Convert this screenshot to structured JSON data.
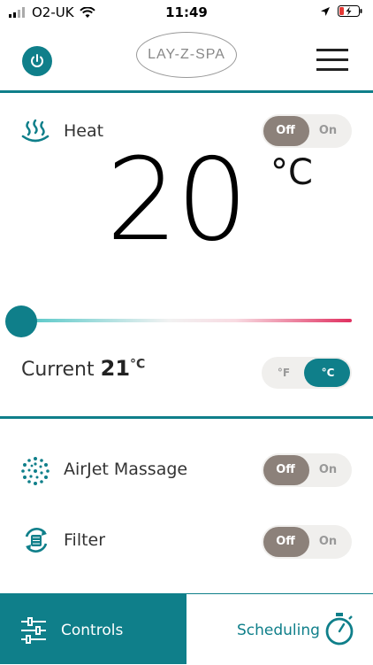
{
  "status_bar": {
    "carrier": "O2-UK",
    "time": "11:49"
  },
  "header": {
    "logo": "LAY-Z-SPA"
  },
  "heat": {
    "label": "Heat",
    "toggle": {
      "off": "Off",
      "on": "On",
      "selected": "Off"
    },
    "temperature": "20",
    "unit": "°C",
    "slider_level": 0,
    "current_label": "Current",
    "current_value": "21",
    "current_unit": "°C",
    "unit_toggle": {
      "f": "°F",
      "c": "°C",
      "selected": "°C"
    }
  },
  "airjet": {
    "label": "AirJet Massage",
    "toggle": {
      "off": "Off",
      "on": "On",
      "selected": "Off"
    }
  },
  "filter": {
    "label": "Filter",
    "toggle": {
      "off": "Off",
      "on": "On",
      "selected": "Off"
    }
  },
  "nav": {
    "controls_label": "Controls",
    "scheduling_label": "Scheduling",
    "active": "Controls"
  },
  "colors": {
    "accent": "#0f7f8a",
    "toggle_off_knob": "#8c817a"
  }
}
